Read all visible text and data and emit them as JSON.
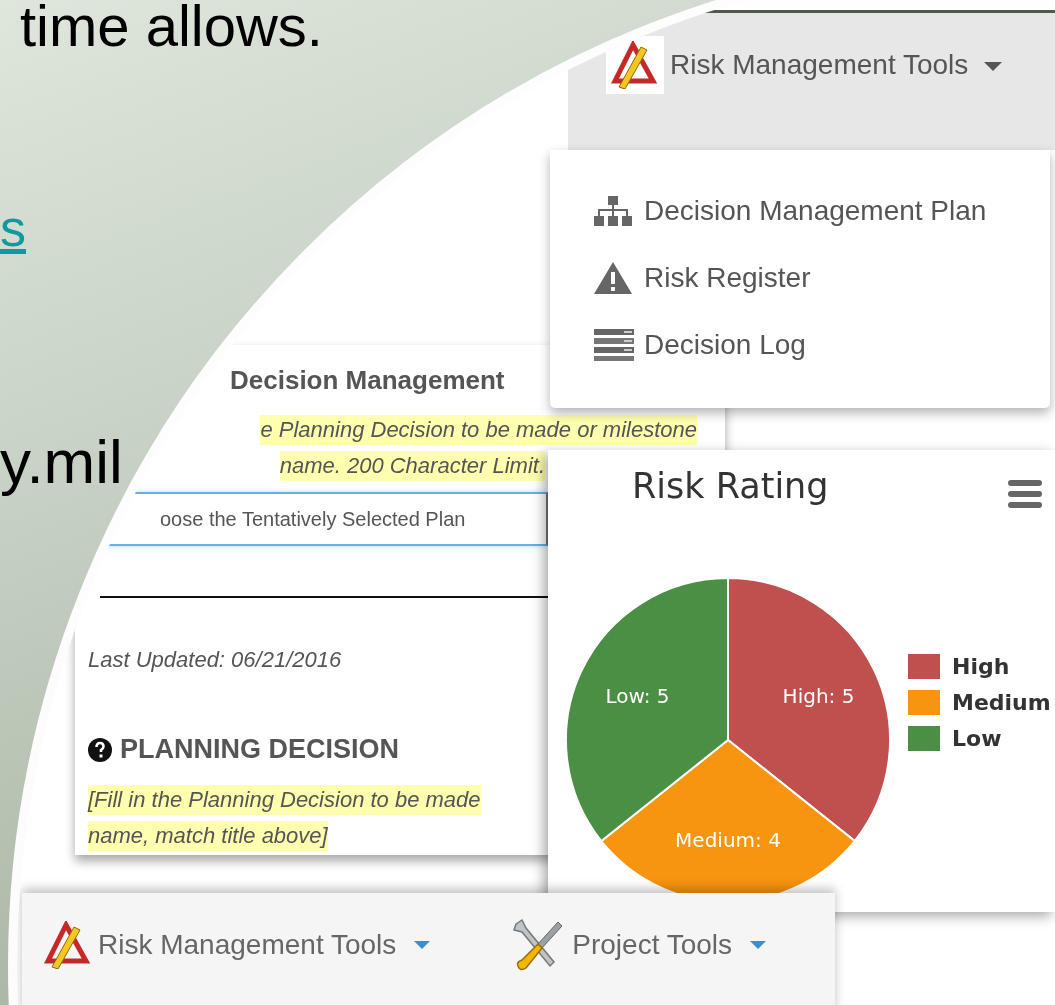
{
  "slide": {
    "texts": [
      {
        "kind": "body",
        "text": "time allows."
      },
      {
        "kind": "link",
        "text": "s"
      },
      {
        "kind": "body",
        "text": "y.mil"
      }
    ]
  },
  "risk_menu": {
    "label": "Risk Management Tools",
    "expanded": true,
    "items": [
      {
        "kind": "hierarchy",
        "label": "Decision Management Plan"
      },
      {
        "kind": "warning",
        "label": "Risk Register"
      },
      {
        "kind": "list",
        "label": "Decision Log"
      }
    ]
  },
  "form": {
    "title": "Decision Management",
    "hint_lines": [
      "e Planning Decision to be made or milestone",
      "name. 200 Character Limit."
    ],
    "title_field": {
      "value": "oose the Tentatively Selected Plan"
    },
    "last_updated": "Last Updated: 06/21/2016",
    "section": {
      "heading": "PLANNING DECISION",
      "hint_lines": [
        "[Fill in the Planning Decision to be made",
        "name, match title above]"
      ]
    }
  },
  "risk_chart": {
    "title": "Risk Rating",
    "legend": [
      {
        "color": "#c0504d"
      },
      {
        "color": "#f79410"
      },
      {
        "color": "#4a8f43"
      }
    ],
    "chart_data": {
      "type": "pie",
      "categories": [
        "High",
        "Medium",
        "Low"
      ],
      "values": [
        5,
        4,
        5
      ],
      "data_labels": true,
      "value_labels": [
        "High: 5",
        "Medium: 4",
        "Low: 5"
      ]
    }
  },
  "nav_bar": {
    "items": [
      {
        "kind": "drafting",
        "label": "Risk Management Tools"
      },
      {
        "kind": "tools",
        "label": "Project Tools"
      }
    ]
  }
}
